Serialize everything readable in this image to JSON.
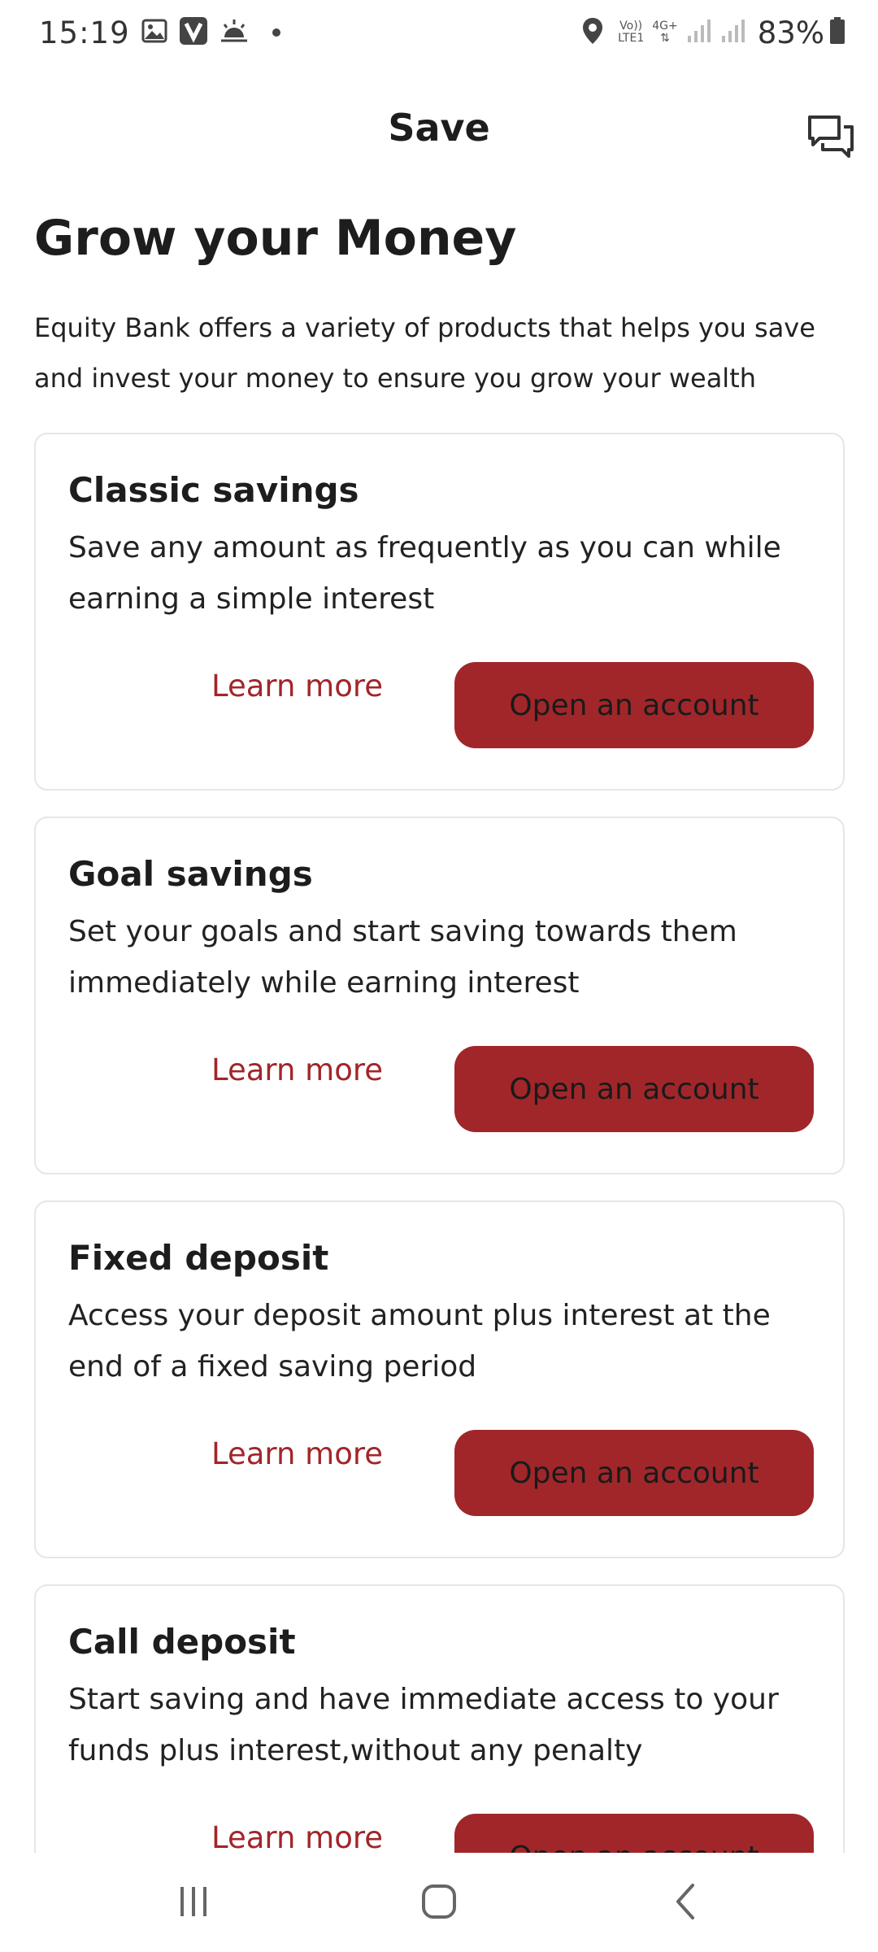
{
  "status_bar": {
    "time": "15:19",
    "network_top": "Vo))",
    "network_bottom": "LTE1",
    "network_type": "4G+",
    "battery": "83%"
  },
  "header": {
    "title": "Save",
    "chat_icon": "chat-bubbles-icon"
  },
  "main": {
    "headline": "Grow your Money",
    "intro": "Equity Bank offers a variety of products that helps you save and invest your money to ensure you grow your wealth",
    "products": [
      {
        "title": "Classic savings",
        "description": "Save any amount as frequently as you can while earning a simple interest",
        "learn_more": "Learn more",
        "open_account": "Open an account"
      },
      {
        "title": "Goal savings",
        "description": "Set your goals and start saving towards them immediately while earning interest",
        "learn_more": "Learn more",
        "open_account": "Open an account"
      },
      {
        "title": "Fixed deposit",
        "description": "Access your deposit amount plus interest at the end of a fixed saving period",
        "learn_more": "Learn more",
        "open_account": "Open an account"
      },
      {
        "title": "Call deposit",
        "description": "Start saving and have immediate access to your funds plus interest,without any penalty",
        "learn_more": "Learn more",
        "open_account": "Open an account"
      }
    ]
  },
  "colors": {
    "accent": "#a1262a",
    "card_border": "#e6e6e6",
    "text": "#1d1d1d"
  }
}
